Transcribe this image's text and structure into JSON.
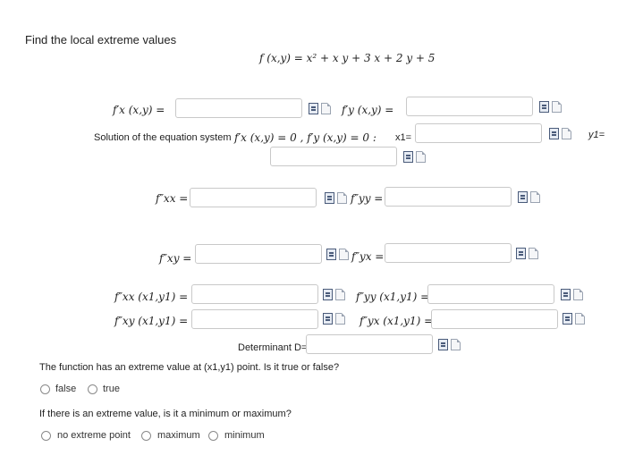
{
  "page": {
    "title": "Find the local extreme values",
    "function": "f (x,y) = x² + x y + 3 x + 2 y + 5"
  },
  "derivatives": {
    "fx_label": "f′x (x,y) =",
    "fy_label": "f′y (x,y) =",
    "system_label": "Solution of the equation system",
    "system_eq": "f′x (x,y) = 0 ,  f′y (x,y) = 0 :",
    "x1_label": "x1=",
    "y1_label": "y1=",
    "fxx_label": "f″xx =",
    "fyy_label": "f″yy =",
    "fxy_label": "f″xy =",
    "fyx_label": "f″yx =",
    "fxx_at_label": "f″xx (x1,y1) =",
    "fyy_at_label": "f″yy (x1,y1) =",
    "fxy_at_label": "f″xy (x1,y1) =",
    "fyx_at_label": "f″yx (x1,y1) =",
    "determinant_label": "Determinant D="
  },
  "question1": {
    "text": "The function has an extreme value at (x1,y1) point. Is it true or false?",
    "options": [
      "false",
      "true"
    ]
  },
  "question2": {
    "text": "If there is an extreme value, is it a minimum or maximum?",
    "options": [
      "no extreme point",
      "maximum",
      "minimum"
    ]
  }
}
